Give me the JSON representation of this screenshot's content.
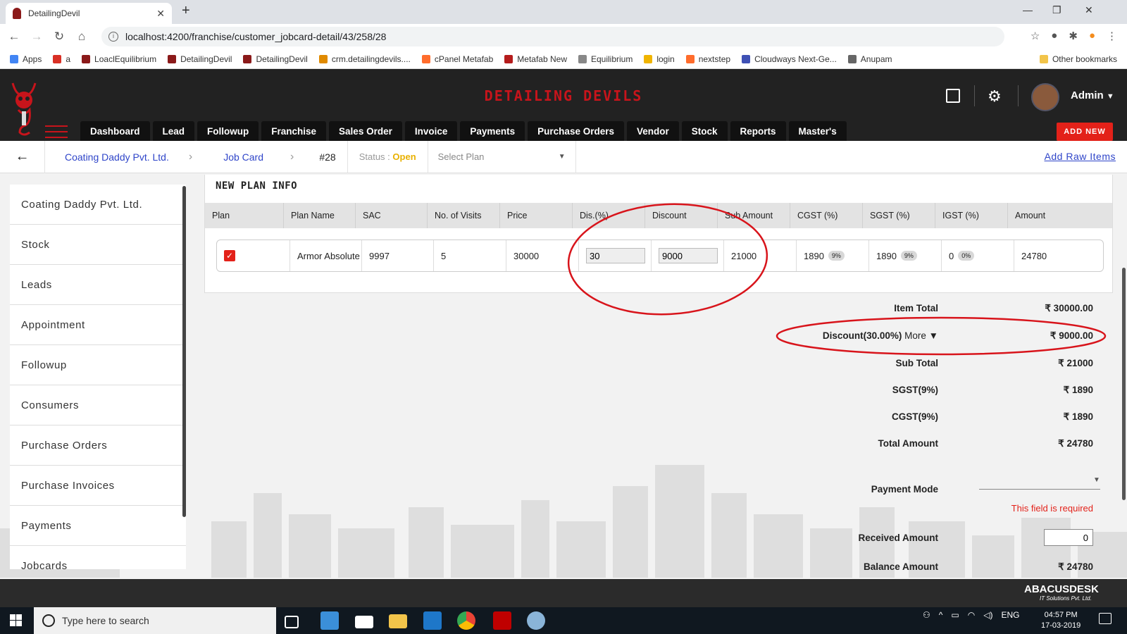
{
  "browser": {
    "tab_title": "DetailingDevil",
    "url": "localhost:4200/franchise/customer_jobcard-detail/43/258/28",
    "bookmarks": [
      "Apps",
      "a",
      "LoaclEquilibrium",
      "DetailingDevil",
      "DetailingDevil",
      "crm.detailingdevils....",
      "cPanel Metafab",
      "Metafab New",
      "Equilibrium",
      "login",
      "nextstep",
      "Cloudways Next-Ge...",
      "Anupam",
      "Other bookmarks"
    ],
    "bookmark_colors": [
      "#4285f4",
      "#d93025",
      "#8b1a1a",
      "#8b1a1a",
      "#8b1a1a",
      "#e08a00",
      "#ff6c2c",
      "#b51c1c",
      "#888888",
      "#f0b400",
      "#ff6c2c",
      "#3f51b5",
      "#666666",
      "#f2c44a"
    ]
  },
  "header": {
    "brand": "DETAILING DEVILS",
    "admin_label": "Admin",
    "add_new": "ADD NEW",
    "nav": [
      "Dashboard",
      "Lead",
      "Followup",
      "Franchise",
      "Sales Order",
      "Invoice",
      "Payments",
      "Purchase Orders",
      "Vendor",
      "Stock",
      "Reports",
      "Master's"
    ]
  },
  "breadcrumb": {
    "back": "←",
    "company": "Coating Daddy Pvt. Ltd.",
    "jobcard": "Job Card",
    "number": "#28",
    "status_label": "Status :",
    "status_value": "Open",
    "select_plan": "Select Plan",
    "add_raw_items": "Add Raw Items"
  },
  "sidebar": {
    "items": [
      "Coating Daddy Pvt. Ltd.",
      "Stock",
      "Leads",
      "Appointment",
      "Followup",
      "Consumers",
      "Purchase Orders",
      "Purchase Invoices",
      "Payments",
      "Jobcards"
    ]
  },
  "plan": {
    "title": "NEW PLAN INFO",
    "columns": [
      "Plan",
      "Plan Name",
      "SAC",
      "No. of Visits",
      "Price",
      "Dis.(%)",
      "Discount",
      "Sub Amount",
      "CGST (%)",
      "SGST (%)",
      "IGST (%)",
      "Amount"
    ],
    "row": {
      "plan_name": "Armor Absolute",
      "sac": "9997",
      "visits": "5",
      "price": "30000",
      "dis_percent": "30",
      "discount": "9000",
      "sub_amount": "21000",
      "cgst": "1890",
      "cgst_pill": "9%",
      "sgst": "1890",
      "sgst_pill": "9%",
      "igst": "0",
      "igst_pill": "0%",
      "amount": "24780"
    }
  },
  "totals": {
    "item_total_label": "Item Total",
    "item_total": "₹ 30000.00",
    "discount_label": "Discount(30.00%)",
    "more": "More ▼",
    "discount": "₹ 9000.00",
    "sub_total_label": "Sub Total",
    "sub_total": "₹ 21000",
    "sgst_label": "SGST(9%)",
    "sgst": "₹ 1890",
    "cgst_label": "CGST(9%)",
    "cgst": "₹ 1890",
    "total_label": "Total Amount",
    "total": "₹ 24780",
    "payment_mode_label": "Payment Mode",
    "required": "This field is required",
    "received_label": "Received Amount",
    "received": "0",
    "balance_label": "Balance Amount",
    "balance": "₹ 24780"
  },
  "footer": {
    "company": "ABACUSDESK",
    "tagline": "IT Solutions Pvt. Ltd."
  },
  "taskbar": {
    "search": "Type here to search",
    "lang": "ENG",
    "time": "04:57 PM",
    "date": "17-03-2019"
  },
  "annotation_color": "#d8141b"
}
